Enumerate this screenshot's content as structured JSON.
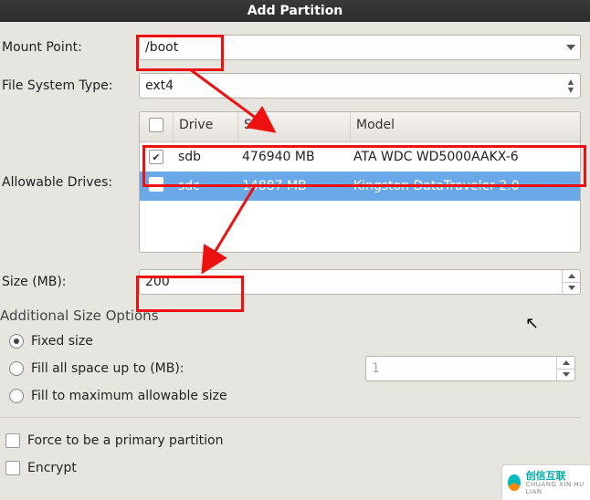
{
  "window": {
    "title": "Add Partition"
  },
  "labels": {
    "mount_point": "Mount Point:",
    "fs_type": "File System Type:",
    "allowable_drives": "Allowable Drives:",
    "size_mb": "Size (MB):",
    "additional_options": "Additional Size Options"
  },
  "fields": {
    "mount_point": "/boot",
    "fs_type": "ext4",
    "size_mb": "200",
    "fill_up_to_mb": "1"
  },
  "drives": {
    "columns": {
      "chk": "",
      "drive": "Drive",
      "size": "Size",
      "model": "Model"
    },
    "rows": [
      {
        "checked": true,
        "drive": "sdb",
        "size": "476940 MB",
        "model": "ATA WDC WD5000AAKX-6",
        "selected": false
      },
      {
        "checked": false,
        "drive": "sdc",
        "size": "14887 MB",
        "model": "Kingston DataTraveler 2.0",
        "selected": true
      }
    ]
  },
  "options": {
    "fixed": "Fixed size",
    "fill_up_to": "Fill all space up to (MB):",
    "fill_max": "Fill to maximum allowable size",
    "selected": "fixed"
  },
  "checkboxes": {
    "force_primary": "Force to be a primary partition",
    "encrypt": "Encrypt"
  },
  "watermark": {
    "line1": "创信互联",
    "line2": "CHUANG XIN HU LIAN"
  }
}
